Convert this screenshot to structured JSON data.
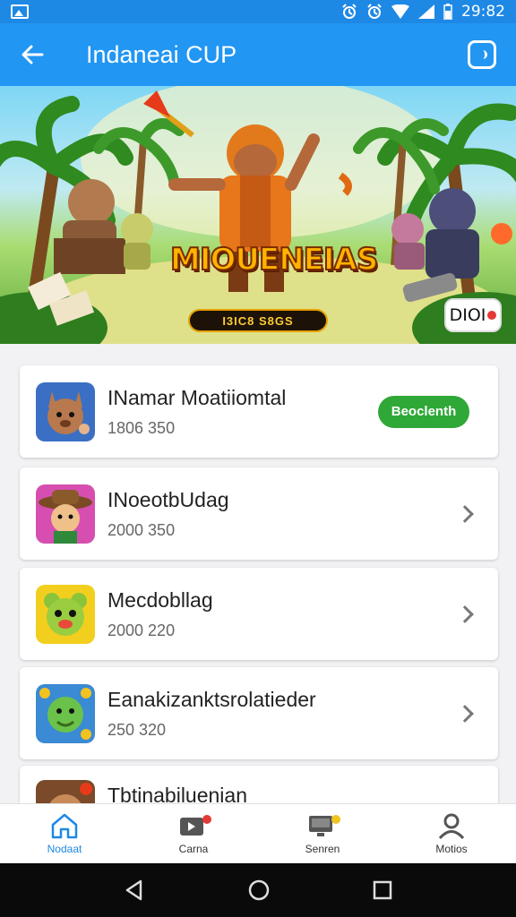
{
  "status_bar": {
    "time": "29:82",
    "icons": [
      "gallery-icon",
      "alarm-icon",
      "alarm-icon",
      "wifi-icon",
      "signal-icon",
      "battery-icon"
    ]
  },
  "app_bar": {
    "title": "Indaneai CUP",
    "back_icon": "back-arrow-icon",
    "action_icon": "square-action-icon"
  },
  "banner": {
    "logo_text": "MIOUENEIAS",
    "pill_text": "I3IC8 S8GS",
    "badge_text": "DIOI"
  },
  "games": [
    {
      "name": "INamar Moatiiomtal",
      "sub": "1806 350",
      "action": "Beoclenth",
      "icon": "kangaroo-icon"
    },
    {
      "name": "INoeotbUdag",
      "sub": "2000 350",
      "action": "",
      "icon": "cowboy-icon"
    },
    {
      "name": "Mecdobllag",
      "sub": "2000 220",
      "action": "",
      "icon": "bear-icon"
    },
    {
      "name": "Eanakizanktsrolatieder",
      "sub": "250 320",
      "action": "",
      "icon": "goblin-icon"
    },
    {
      "name": "Tbtinabiluenian",
      "sub": "",
      "action": "",
      "icon": "warrior-icon"
    }
  ],
  "bottom_nav": [
    {
      "label": "Nodaat",
      "icon": "home-icon",
      "active": true
    },
    {
      "label": "Carna",
      "icon": "games-icon",
      "active": false
    },
    {
      "label": "Senren",
      "icon": "monitor-icon",
      "active": false
    },
    {
      "label": "Motios",
      "icon": "profile-icon",
      "active": false
    }
  ],
  "colors": {
    "app_bar": "#2196f3",
    "status_bar": "#1e88e5",
    "accent": "#2fa838",
    "active_nav": "#1e88e5"
  }
}
